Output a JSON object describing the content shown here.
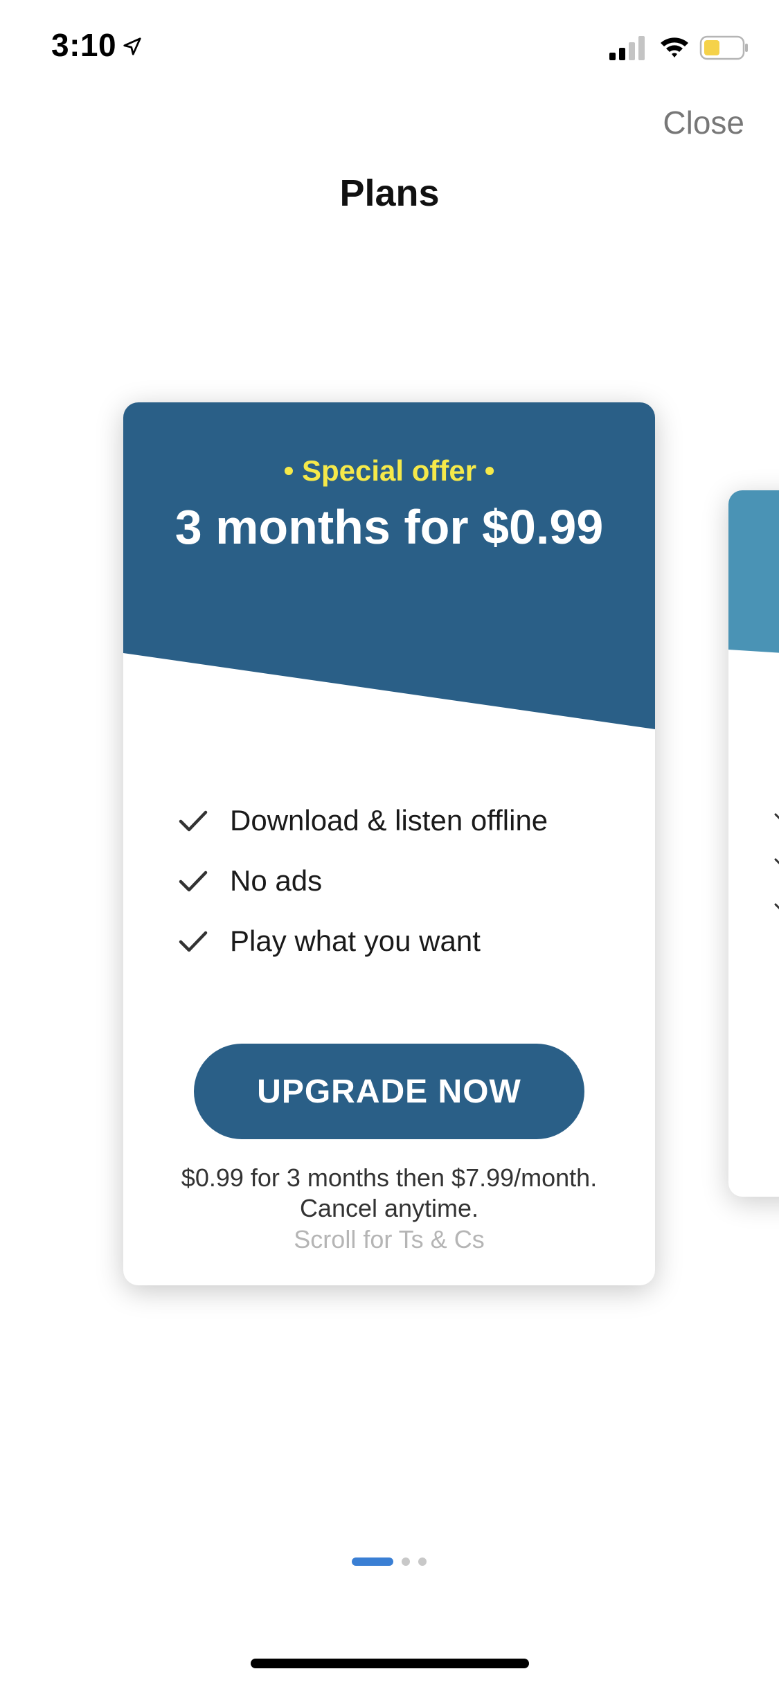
{
  "status_bar": {
    "time": "3:10",
    "icons": [
      "location-arrow-icon",
      "cellular-signal-icon",
      "wifi-icon",
      "battery-icon"
    ],
    "battery_color": "#f5d24a"
  },
  "header": {
    "close_label": "Close",
    "title": "Plans"
  },
  "plan_card": {
    "offer_tag": "• Special offer •",
    "offer_title": "3 months for $0.99",
    "header_color": "#2a5f87",
    "offer_tag_color": "#f5e94a",
    "features": [
      {
        "label": "Download & listen offline"
      },
      {
        "label": "No ads"
      },
      {
        "label": "Play what you want"
      }
    ],
    "button_label": "UPGRADE NOW",
    "price_note_line1": "$0.99 for 3 months then $7.99/month.",
    "price_note_line2": "Cancel anytime.",
    "terms_note": "Scroll for Ts & Cs"
  },
  "next_card": {
    "header_color": "#4a93b5"
  },
  "pagination": {
    "pages": 3,
    "current_page": 1,
    "active_color": "#3a7fd4"
  }
}
